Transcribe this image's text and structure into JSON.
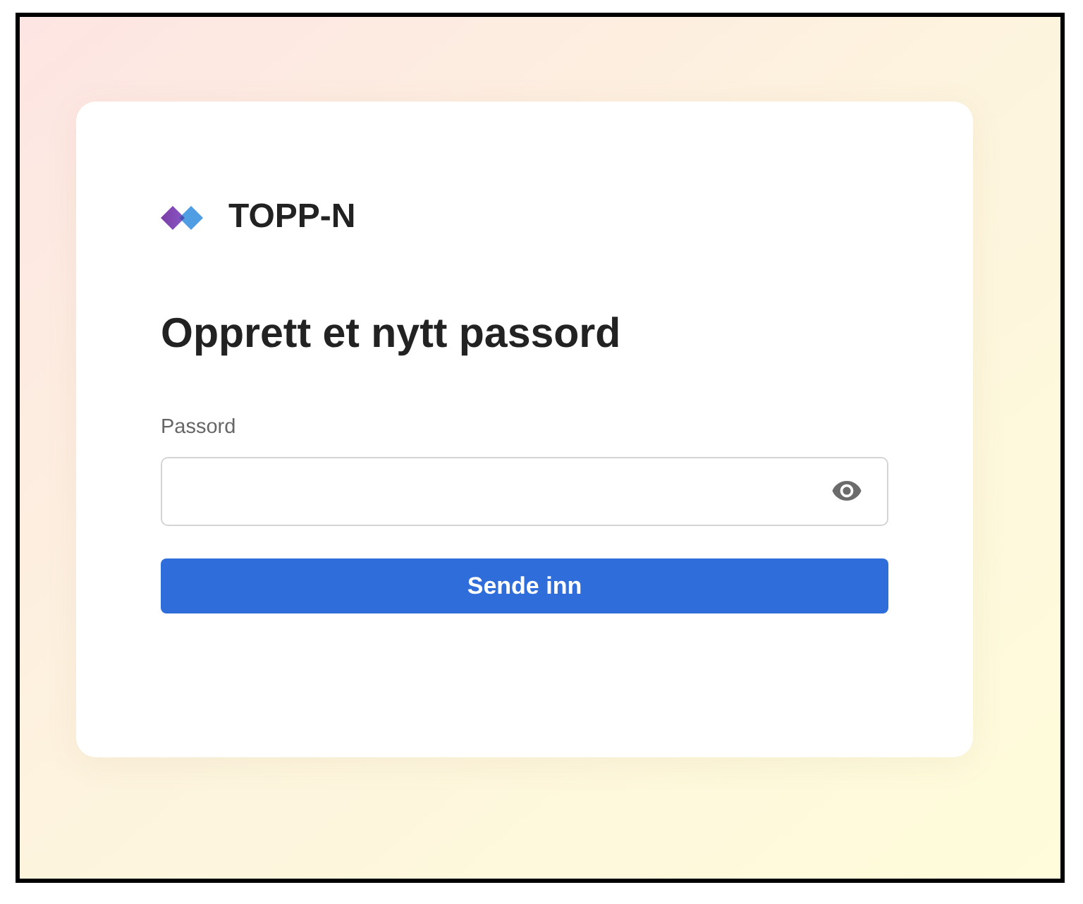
{
  "brand": {
    "name": "TOPP-N"
  },
  "heading": "Opprett et nytt passord",
  "password_field": {
    "label": "Passord"
  },
  "submit_button": {
    "label": "Sende inn"
  }
}
